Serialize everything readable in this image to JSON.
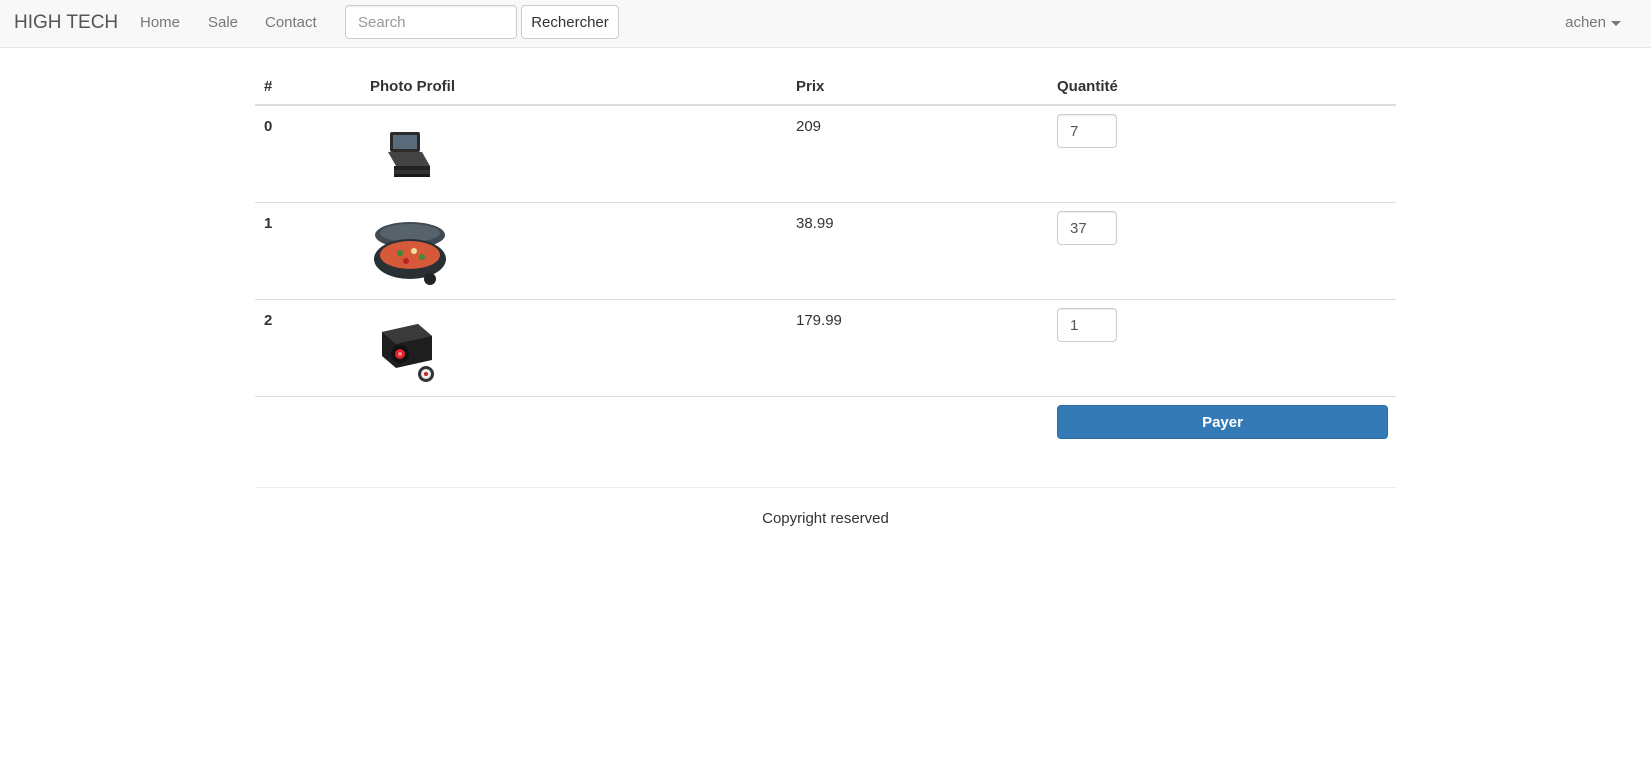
{
  "navbar": {
    "brand": "HIGH TECH",
    "links": [
      "Home",
      "Sale",
      "Contact"
    ],
    "search": {
      "placeholder": "Search",
      "value": ""
    },
    "search_button": "Rechercher",
    "user": "achen"
  },
  "table": {
    "headers": [
      "#",
      "Photo Profil",
      "Prix",
      "Quantité"
    ],
    "rows": [
      {
        "index": "0",
        "image": "laptop-product-image",
        "price": "209",
        "quantity": "7"
      },
      {
        "index": "1",
        "image": "pizza-maker-product-image",
        "price": "38.99",
        "quantity": "37"
      },
      {
        "index": "2",
        "image": "projector-product-image",
        "price": "179.99",
        "quantity": "1"
      }
    ],
    "pay_button": "Payer"
  },
  "footer": {
    "text": "Copyright reserved"
  }
}
